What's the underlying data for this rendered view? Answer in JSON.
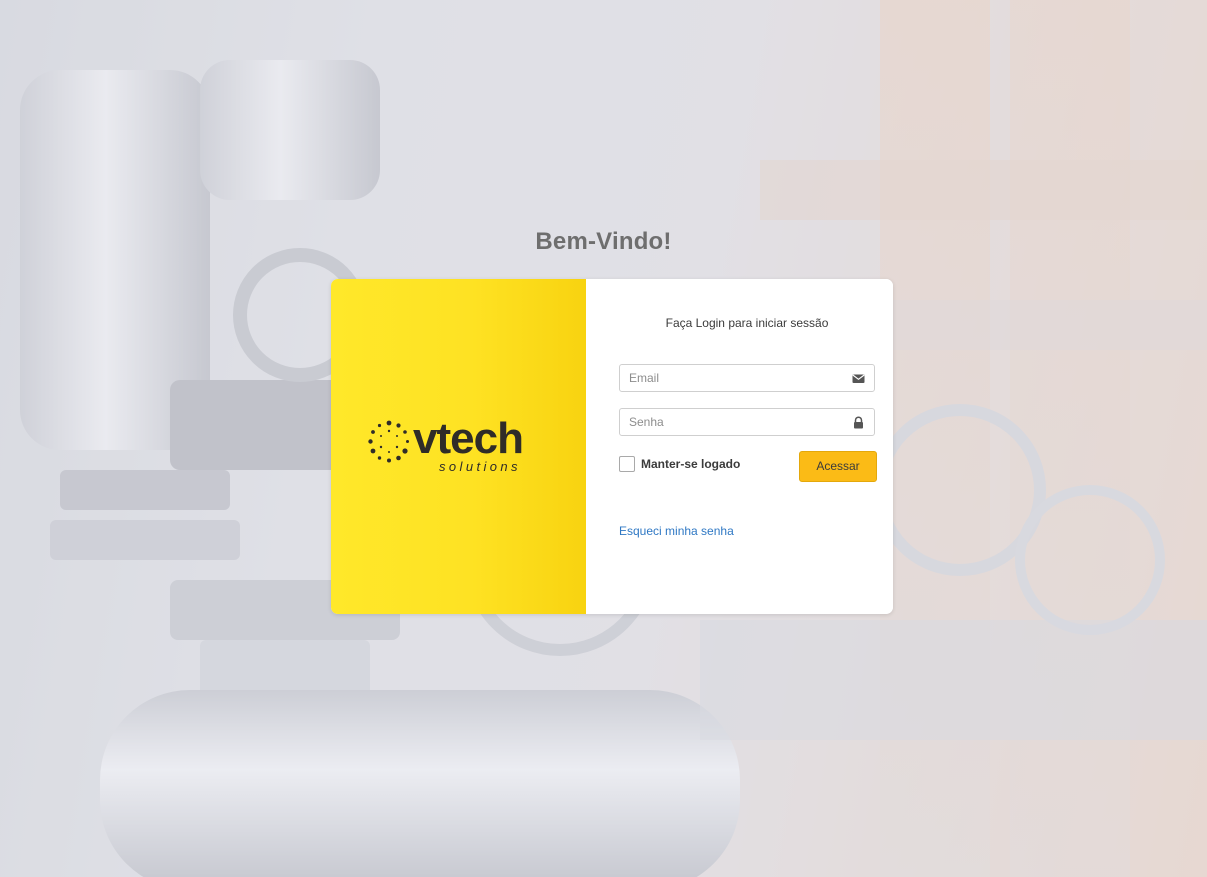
{
  "welcome_title": "Bem-Vindo!",
  "brand": {
    "name": "vtech",
    "tagline": "solutions"
  },
  "login": {
    "title": "Faça Login para iniciar sessão",
    "email": {
      "placeholder": "Email",
      "value": "",
      "icon": "envelope-icon"
    },
    "password": {
      "placeholder": "Senha",
      "value": "",
      "icon": "lock-icon"
    },
    "remember_label": "Manter-se logado",
    "remember_checked": false,
    "submit_label": "Acessar",
    "forgot_label": "Esqueci minha senha"
  },
  "colors": {
    "brand_yellow": "#fee223",
    "button_yellow": "#fbbb16",
    "link_blue": "#2f78c4",
    "logo_dark": "#2f2c28"
  }
}
